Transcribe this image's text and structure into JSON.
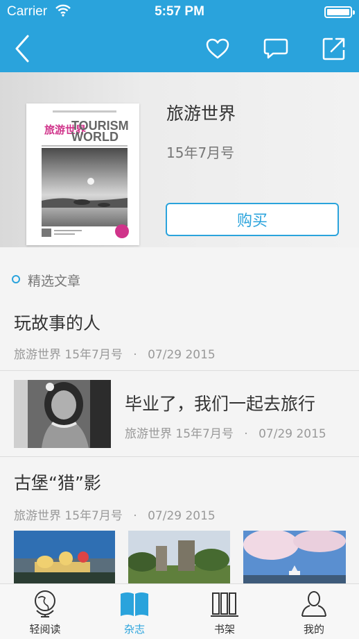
{
  "status_bar": {
    "carrier": "Carrier",
    "time": "5:57 PM"
  },
  "nav": {
    "icons": [
      "back-chevron-icon",
      "heart-icon",
      "comment-icon",
      "share-icon"
    ]
  },
  "magazine": {
    "title": "旅游世界",
    "issue": "15年7月号",
    "buy_label": "购买",
    "cover_text": {
      "cn": "旅游世界",
      "en1": "TOURISM",
      "en2": "WORLD"
    }
  },
  "section": {
    "label": "精选文章"
  },
  "articles": [
    {
      "title": "玩故事的人",
      "source": "旅游世界 15年7月号",
      "date": "07/29 2015"
    },
    {
      "title": "毕业了，我们一起去旅行",
      "source": "旅游世界 15年7月号",
      "date": "07/29 2015"
    },
    {
      "title": "古堡“猎”影",
      "source": "旅游世界 15年7月号",
      "date": "07/29 2015"
    }
  ],
  "meta_sep": "·",
  "tabs": [
    {
      "label": "轻阅读",
      "icon": "globe-icon",
      "active": false
    },
    {
      "label": "杂志",
      "icon": "open-book-icon",
      "active": true
    },
    {
      "label": "书架",
      "icon": "bookshelf-icon",
      "active": false
    },
    {
      "label": "我的",
      "icon": "person-icon",
      "active": false
    }
  ],
  "colors": {
    "accent": "#2aa3dc",
    "text": "#333333",
    "muted": "#999999"
  }
}
